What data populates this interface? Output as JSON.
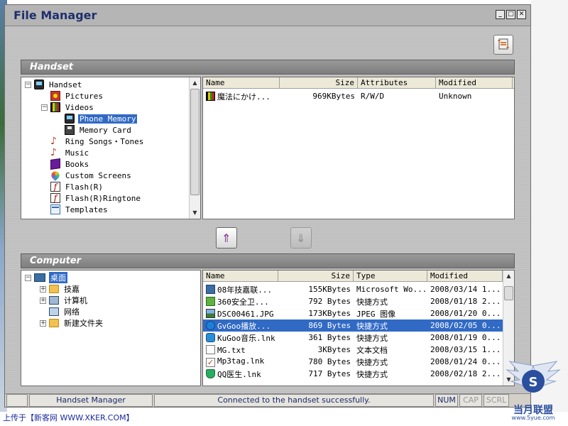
{
  "window": {
    "title": "File Manager",
    "controls": [
      "_",
      "□",
      "✕"
    ]
  },
  "handset": {
    "section_title": "Handset",
    "tree": [
      {
        "label": "Handset",
        "expander": "−",
        "depth": 0,
        "icon": "phone-icon"
      },
      {
        "label": "Pictures",
        "depth": 1,
        "icon": "picture-icon"
      },
      {
        "label": "Videos",
        "expander": "−",
        "depth": 1,
        "icon": "film-icon"
      },
      {
        "label": "Phone Memory",
        "depth": 2,
        "icon": "phone-icon",
        "selected": true
      },
      {
        "label": "Memory Card",
        "depth": 2,
        "icon": "memory-card-icon"
      },
      {
        "label": "Ring Songs・Tones",
        "depth": 1,
        "icon": "music-note-icon"
      },
      {
        "label": "Music",
        "depth": 1,
        "icon": "music-note-icon"
      },
      {
        "label": "Books",
        "depth": 1,
        "icon": "book-icon"
      },
      {
        "label": "Custom Screens",
        "depth": 1,
        "icon": "color-drop-icon"
      },
      {
        "label": "Flash(R)",
        "depth": 1,
        "icon": "flash-icon"
      },
      {
        "label": "Flash(R)Ringtone",
        "depth": 1,
        "icon": "flash-icon"
      },
      {
        "label": "Templates",
        "depth": 1,
        "icon": "template-icon"
      }
    ],
    "columns": [
      "Name",
      "Size",
      "Attributes",
      "Modified"
    ],
    "files": [
      {
        "name": "魔法にかけ...",
        "size": "969KBytes",
        "attributes": "R/W/D",
        "modified": "Unknown"
      }
    ]
  },
  "computer": {
    "section_title": "Computer",
    "tree": [
      {
        "label": "桌面",
        "expander": "−",
        "depth": 0,
        "icon": "desktop-icon",
        "selected": true
      },
      {
        "label": "技嘉",
        "expander": "+",
        "depth": 1,
        "icon": "folder-icon"
      },
      {
        "label": "计算机",
        "expander": "+",
        "depth": 1,
        "icon": "computer-icon"
      },
      {
        "label": "网络",
        "depth": 1,
        "icon": "network-icon"
      },
      {
        "label": "新建文件夹",
        "expander": "+",
        "depth": 1,
        "icon": "folder-icon"
      }
    ],
    "columns": [
      "Name",
      "Size",
      "Type",
      "Modified"
    ],
    "files": [
      {
        "name": "08年技嘉联...",
        "size": "155KBytes",
        "type": "Microsoft Wo...",
        "modified": "2008/03/14 1...",
        "icon": "f-lnk"
      },
      {
        "name": "360安全卫...",
        "size": "792 Bytes",
        "type": "快捷方式",
        "modified": "2008/01/18 2...",
        "icon": "f-green"
      },
      {
        "name": "DSC00461.JPG",
        "size": "173KBytes",
        "type": "JPEG 图像",
        "modified": "2008/01/20 0...",
        "icon": "f-jpg"
      },
      {
        "name": "GvGoo播放...",
        "size": "869 Bytes",
        "type": "快捷方式",
        "modified": "2008/02/05 0...",
        "icon": "f-gv",
        "selected": true
      },
      {
        "name": "KuGoo音乐.lnk",
        "size": "361 Bytes",
        "type": "快捷方式",
        "modified": "2008/01/19 0...",
        "icon": "f-kw"
      },
      {
        "name": "MG.txt",
        "size": "3KBytes",
        "type": "文本文档",
        "modified": "2008/03/15 1...",
        "icon": "f-txt"
      },
      {
        "name": "Mp3tag.lnk",
        "size": "780 Bytes",
        "type": "快捷方式",
        "modified": "2008/01/24 0...",
        "icon": "f-check"
      },
      {
        "name": "QQ医生.lnk",
        "size": "717 Bytes",
        "type": "快捷方式",
        "modified": "2008/02/18 2...",
        "icon": "f-shield"
      }
    ]
  },
  "status": {
    "app": "Handset Manager",
    "message": "Connected to the handset successfully.",
    "num": "NUM",
    "cap": "CAP",
    "scrl": "SCRL"
  },
  "caption": "上传于【新客网 WWW.XKER.COM】",
  "logo": {
    "text": "当月联盟",
    "url": "www.5yue.com"
  }
}
